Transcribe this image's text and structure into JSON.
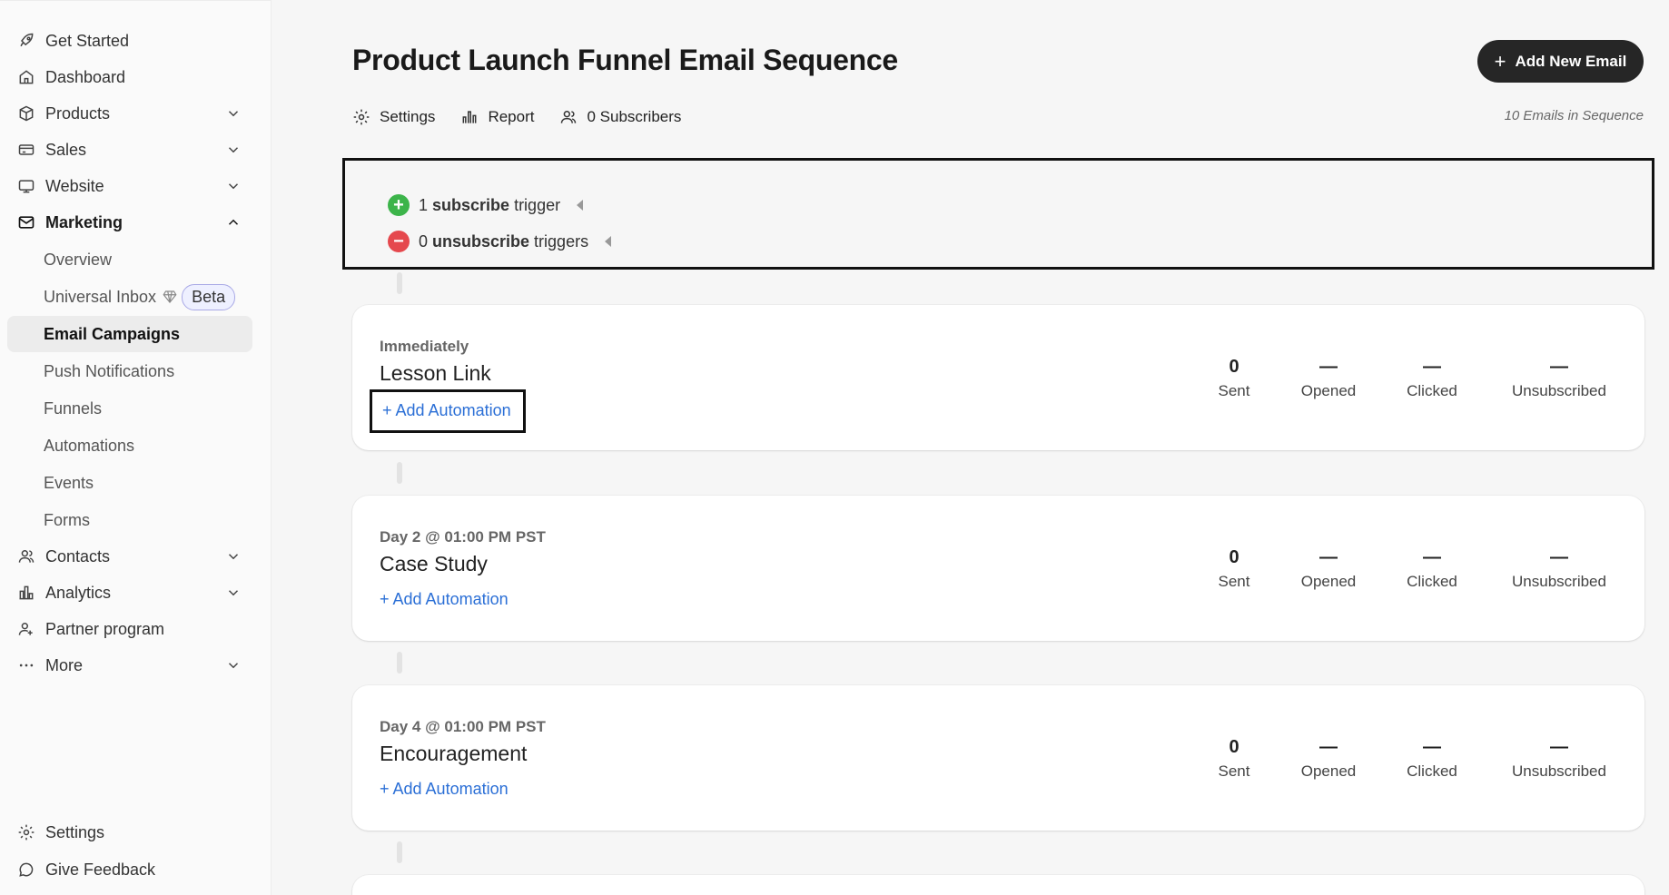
{
  "sidebar": {
    "items": [
      {
        "label": "Get Started",
        "icon": "rocket-icon"
      },
      {
        "label": "Dashboard",
        "icon": "home-icon"
      },
      {
        "label": "Products",
        "icon": "box-icon"
      },
      {
        "label": "Sales",
        "icon": "credit-card-icon"
      },
      {
        "label": "Website",
        "icon": "monitor-icon"
      },
      {
        "label": "Marketing",
        "icon": "mail-icon"
      }
    ],
    "marketing_sub": [
      {
        "label": "Overview"
      },
      {
        "label": "Universal Inbox",
        "badge": "Beta"
      },
      {
        "label": "Email Campaigns"
      },
      {
        "label": "Push Notifications"
      },
      {
        "label": "Funnels"
      },
      {
        "label": "Automations"
      },
      {
        "label": "Events"
      },
      {
        "label": "Forms"
      }
    ],
    "items2": [
      {
        "label": "Contacts",
        "icon": "users-icon"
      },
      {
        "label": "Analytics",
        "icon": "bar-chart-icon"
      },
      {
        "label": "Partner program",
        "icon": "user-plus-icon"
      },
      {
        "label": "More",
        "icon": "dots-icon"
      }
    ],
    "footer": [
      {
        "label": "Settings",
        "icon": "gear-icon"
      },
      {
        "label": "Give Feedback",
        "icon": "chat-icon"
      }
    ]
  },
  "header": {
    "title": "Product Launch Funnel Email Sequence",
    "add_button": "Add New Email",
    "tabs": {
      "settings": "Settings",
      "report": "Report",
      "subscribers": "0 Subscribers"
    },
    "email_count": "10 Emails in Sequence"
  },
  "triggers": {
    "subscribe": {
      "count": "1",
      "bold": "subscribe",
      "rest": "trigger"
    },
    "unsubscribe": {
      "count": "0",
      "bold": "unsubscribe",
      "rest": "triggers"
    }
  },
  "stat_labels": {
    "sent": "Sent",
    "opened": "Opened",
    "clicked": "Clicked",
    "unsubscribed": "Unsubscribed"
  },
  "emails": [
    {
      "when": "Immediately",
      "name": "Lesson Link",
      "add": "+ Add Automation",
      "sent": "0",
      "opened": "—",
      "clicked": "—",
      "unsubscribed": "—"
    },
    {
      "when": "Day 2 @ 01:00 PM PST",
      "name": "Case Study",
      "add": "+ Add Automation",
      "sent": "0",
      "opened": "—",
      "clicked": "—",
      "unsubscribed": "—"
    },
    {
      "when": "Day 4 @ 01:00 PM PST",
      "name": "Encouragement",
      "add": "+ Add Automation",
      "sent": "0",
      "opened": "—",
      "clicked": "—",
      "unsubscribed": "—"
    }
  ],
  "colors": {
    "accent_link": "#2b6fd6",
    "subscribe_green": "#3cb44a",
    "unsubscribe_red": "#e5484d",
    "button_dark": "#262626"
  }
}
